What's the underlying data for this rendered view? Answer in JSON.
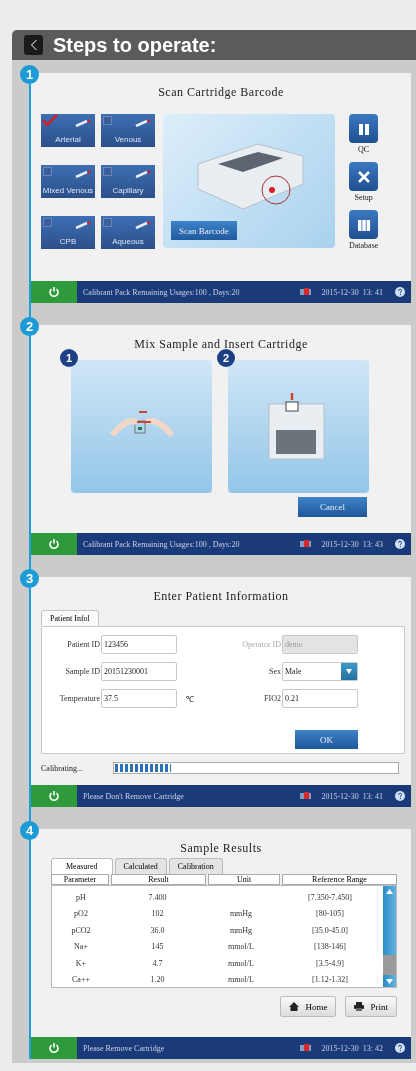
{
  "header": {
    "title": "Steps to operate:"
  },
  "steps": [
    {
      "kind": "scan",
      "number": "1",
      "title": "Scan Cartridge Barcode",
      "sample_types": [
        {
          "label": "Arterial",
          "checked": true
        },
        {
          "label": "Venous",
          "checked": false
        },
        {
          "label": "Mixed Venous",
          "checked": false
        },
        {
          "label": "Capillary",
          "checked": false
        },
        {
          "label": "CPB",
          "checked": false
        },
        {
          "label": "Aqueous",
          "checked": false
        }
      ],
      "scan_button": "Scan Barcode",
      "side_buttons": [
        {
          "kind": "qc",
          "label": "QC"
        },
        {
          "kind": "setup",
          "label": "Setup"
        },
        {
          "kind": "database",
          "label": "Database"
        }
      ],
      "status_bar": {
        "message": "Calibrant Pack Remaining Usages:100 , Days:20",
        "datetime": "2015-12-30  13: 41"
      }
    },
    {
      "kind": "insert",
      "number": "2",
      "title": "Mix Sample and Insert Cartridge",
      "panels": [
        {
          "kind": "mix",
          "number": "1"
        },
        {
          "kind": "insert",
          "number": "2"
        }
      ],
      "cancel_button": "Cancel",
      "status_bar": {
        "message": "Calibrant Pack Remaining Usages:100 , Days:20",
        "datetime": "2015-12-30  13: 43"
      }
    },
    {
      "kind": "patient",
      "number": "3",
      "title": "Enter Patient Information",
      "tab": "Patient Infol",
      "fields": [
        {
          "kind": "text",
          "label": "Patient ID",
          "value": "123456",
          "disabled": false
        },
        {
          "kind": "text",
          "label": "Operator ID",
          "value": "demo",
          "disabled": true
        },
        {
          "kind": "text",
          "label": "Sample ID",
          "value": "20151230001",
          "disabled": false
        },
        {
          "kind": "dropdown",
          "label": "Sex",
          "value": "Male",
          "disabled": false
        },
        {
          "kind": "text",
          "label": "Temperature",
          "value": "37.5",
          "unit": "℃",
          "disabled": false
        },
        {
          "kind": "text",
          "label": "FIO2",
          "value": "0.21",
          "disabled": false
        }
      ],
      "ok_button": "OK",
      "progress": {
        "label": "Calibrating...",
        "level": 0.2
      },
      "status_bar": {
        "message": "Please Don't Remove Cartridge",
        "datetime": "2015-12-30  13: 41"
      }
    },
    {
      "kind": "results",
      "number": "4",
      "title": "Sample Results",
      "tabs": [
        {
          "label": "Measured",
          "selected": true
        },
        {
          "label": "Calculated",
          "selected": false
        },
        {
          "label": "Calibration",
          "selected": false
        }
      ],
      "columns": [
        "Parameter",
        "Result",
        "Unit",
        "Reference Range"
      ],
      "rows": [
        [
          "pH",
          "7.400",
          "",
          "[7.350-7.450]"
        ],
        [
          "pO2",
          "102",
          "mmHg",
          "[80-105]"
        ],
        [
          "pCO2",
          "36.0",
          "mmHg",
          "[35.0-45.0]"
        ],
        [
          "Na+",
          "145",
          "mmol/L",
          "[138-146]"
        ],
        [
          "K+",
          "4.7",
          "mmol/L",
          "[3.5-4.9]"
        ],
        [
          "Ca++",
          "1.20",
          "mmol/L",
          "[1.12-1.32]"
        ]
      ],
      "buttons": [
        {
          "kind": "home",
          "label": "Home"
        },
        {
          "kind": "print",
          "label": "Print"
        }
      ],
      "status_bar": {
        "message": "Please Remove Cartridge",
        "datetime": "2015-12-30  13: 42"
      }
    }
  ]
}
